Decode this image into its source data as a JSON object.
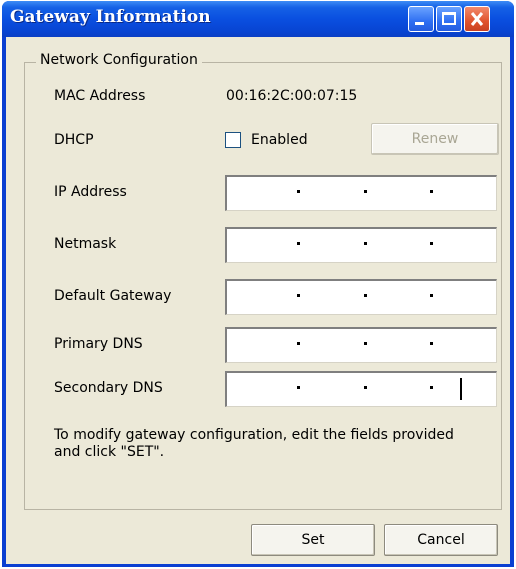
{
  "window": {
    "title": "Gateway Information"
  },
  "group": {
    "legend": "Network Configuration"
  },
  "mac": {
    "label": "MAC Address",
    "value": "00:16:2C:00:07:15"
  },
  "dhcp": {
    "label": "DHCP",
    "checkbox_label": "Enabled",
    "checked": false,
    "renew_label": "Renew",
    "renew_enabled": false
  },
  "fields": [
    {
      "label": "IP Address",
      "value": " .  .  . "
    },
    {
      "label": "Netmask",
      "value": " .  .  . "
    },
    {
      "label": "Default Gateway",
      "value": " .  .  . "
    },
    {
      "label": "Primary DNS",
      "value": " .  .  . "
    },
    {
      "label": "Secondary DNS",
      "value": " .  .  . "
    }
  ],
  "note": "To modify gateway configuration, edit the fields provided and click \"SET\".",
  "buttons": {
    "set": "Set",
    "cancel": "Cancel"
  },
  "colors": {
    "titlebar": "#0a4fe0",
    "client": "#ece9d8",
    "close": "#e0532d"
  }
}
